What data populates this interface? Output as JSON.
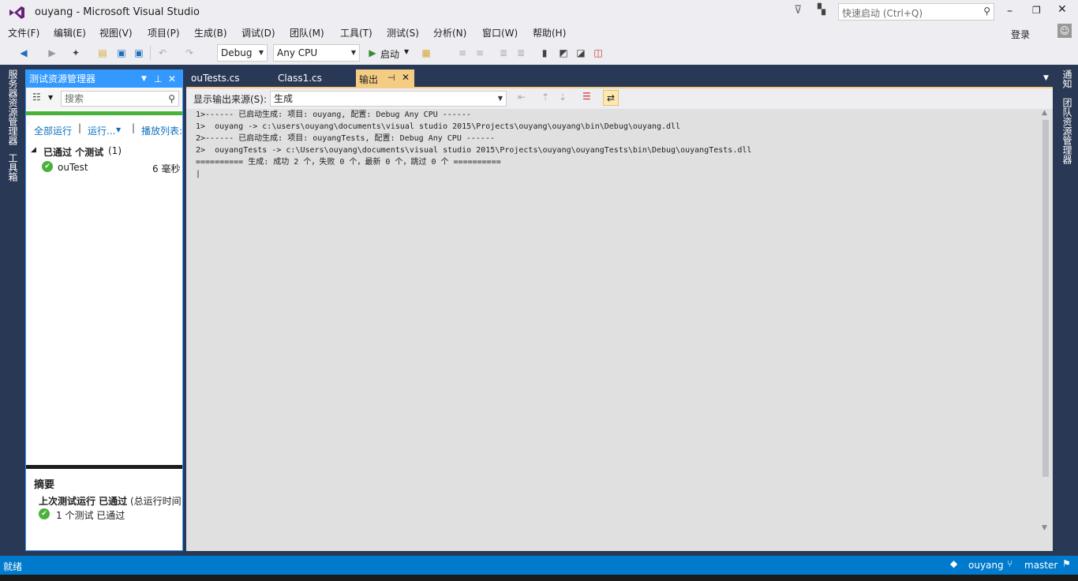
{
  "app": {
    "title": "ouyang - Microsoft Visual Studio",
    "quick_launch_placeholder": "快速启动 (Ctrl+Q)",
    "login": "登录"
  },
  "menu": [
    "文件(F)",
    "编辑(E)",
    "视图(V)",
    "项目(P)",
    "生成(B)",
    "调试(D)",
    "团队(M)",
    "工具(T)",
    "测试(S)",
    "分析(N)",
    "窗口(W)",
    "帮助(H)"
  ],
  "toolbar": {
    "config": "Debug",
    "platform": "Any CPU",
    "start_label": "启动"
  },
  "left_strip": {
    "tab1": "服务器资源管理器",
    "tab2": "工具箱"
  },
  "right_strip": {
    "tab1": "通知",
    "tab2": "团队资源管理器"
  },
  "test_explorer": {
    "title": "测试资源管理器",
    "search_placeholder": "搜索",
    "links": {
      "run_all": "全部运行",
      "run": "运行...",
      "playlist": "播放列表:"
    },
    "group_label": "已通过 个测试",
    "group_count": "(1)",
    "test_name": "ouTest",
    "test_time": "6 毫秒",
    "summary_title": "摘要",
    "last_run": "上次测试运行 已通过",
    "last_run_detail": "(总运行时间",
    "passed": "1 个测试 已通过"
  },
  "tabs": [
    {
      "label": "ouTests.cs"
    },
    {
      "label": "Class1.cs"
    },
    {
      "label": "输出"
    }
  ],
  "output": {
    "source_label": "显示输出来源(S):",
    "source_value": "生成",
    "lines": [
      "1>------ 已启动生成: 项目: ouyang, 配置: Debug Any CPU ------",
      "1>  ouyang -> c:\\users\\ouyang\\documents\\visual studio 2015\\Projects\\ouyang\\ouyang\\bin\\Debug\\ouyang.dll",
      "2>------ 已启动生成: 项目: ouyangTests, 配置: Debug Any CPU ------",
      "2>  ouyangTests -> c:\\Users\\ouyang\\documents\\visual studio 2015\\Projects\\ouyang\\ouyangTests\\bin\\Debug\\ouyangTests.dll",
      "========== 生成: 成功 2 个，失败 0 个，最新 0 个，跳过 0 个 =========="
    ]
  },
  "status": {
    "ready": "就绪",
    "repo": "ouyang",
    "branch": "master"
  },
  "colors": {
    "accent": "#007acc",
    "pass": "#4ab13b",
    "chrome": "#293955",
    "tab_active": "#f5cc84"
  }
}
